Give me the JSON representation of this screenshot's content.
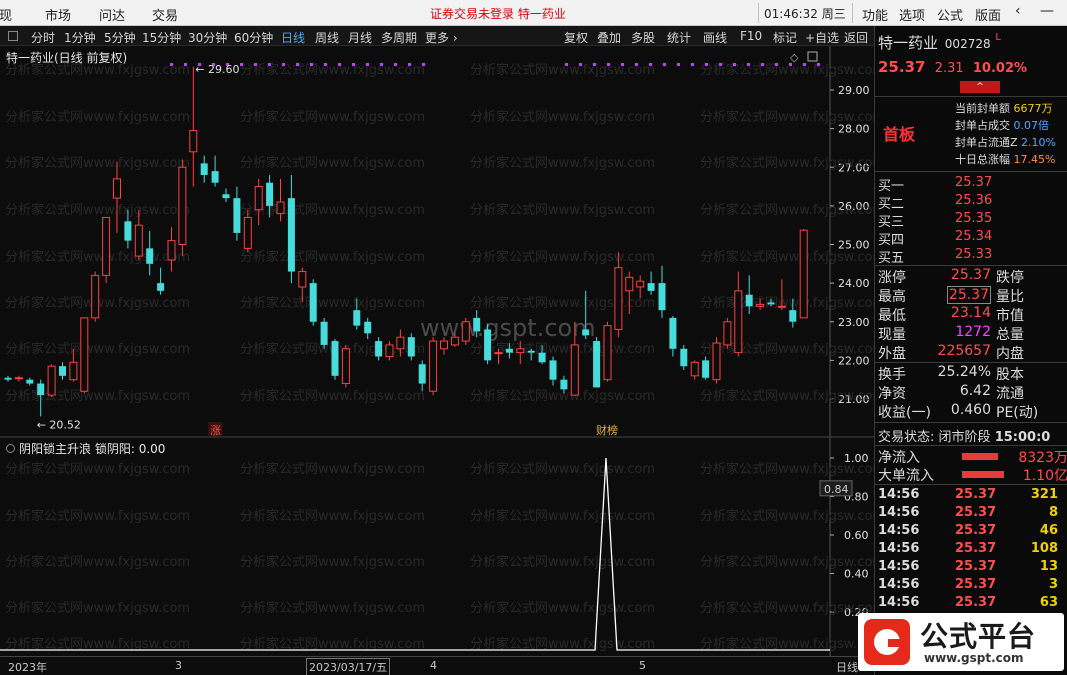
{
  "top_menu": {
    "items": [
      "发现",
      "市场",
      "问达",
      "交易"
    ],
    "center_text": "证券交易未登录  特一药业",
    "clock": "01:46:32 周三",
    "right_items": [
      "功能",
      "选项",
      "公式",
      "版面"
    ],
    "collapse_glyph": "‹",
    "minimize_glyph": "—",
    "close_glyph": "✕"
  },
  "period_bar": {
    "tabs": [
      "分时",
      "1分钟",
      "5分钟",
      "15分钟",
      "30分钟",
      "60分钟",
      "日线",
      "周线",
      "月线",
      "多周期",
      "更多 ›"
    ],
    "active": "日线",
    "tools": [
      "复权",
      "叠加",
      "多股",
      "统计",
      "画线",
      "F10",
      "标记",
      "+自选",
      "返回"
    ]
  },
  "main_chart": {
    "title": "特一药业(日线 前复权)",
    "high_label": "29.60",
    "low_label": "20.52",
    "tags": {
      "zhang": "涨",
      "caibang": "财榜"
    },
    "watermark": "www.gspt.com",
    "watermark_repeat": "分析家公式网www.fxjgsw.com"
  },
  "indicator": {
    "title": "阴阳锁主升浪",
    "var_label": "锁阴阳:",
    "var_value": "0.00",
    "current_value": "0.84"
  },
  "time_axis": {
    "labels": [
      "2023年",
      "3",
      "2023/03/17/五",
      "4",
      "5"
    ],
    "period": "日线"
  },
  "colors": {
    "up": "#ff4040",
    "down": "#46dcdc",
    "axis": "#e0e0e0",
    "dots": "#c040ff",
    "panel_bg": "#0c0c0c"
  },
  "chart_data": [
    {
      "type": "candlestick",
      "title": "特一药业(日线 前复权)",
      "ylim": [
        20.4,
        29.9
      ],
      "y_ticks": [
        "29.00",
        "28.00",
        "27.00",
        "26.00",
        "25.00",
        "24.00",
        "23.00",
        "22.00",
        "21.00"
      ],
      "candles": [
        {
          "o": 21.55,
          "h": 21.6,
          "l": 21.45,
          "c": 21.5
        },
        {
          "o": 21.55,
          "h": 21.6,
          "l": 21.45,
          "c": 21.55
        },
        {
          "o": 21.5,
          "h": 21.55,
          "l": 21.35,
          "c": 21.4
        },
        {
          "o": 21.4,
          "h": 21.5,
          "l": 20.55,
          "c": 21.1
        },
        {
          "o": 21.1,
          "h": 21.9,
          "l": 21.05,
          "c": 21.85
        },
        {
          "o": 21.85,
          "h": 21.95,
          "l": 21.5,
          "c": 21.6
        },
        {
          "o": 21.5,
          "h": 22.3,
          "l": 21.45,
          "c": 21.95
        },
        {
          "o": 21.2,
          "h": 23.1,
          "l": 21.15,
          "c": 23.1
        },
        {
          "o": 23.1,
          "h": 24.3,
          "l": 23.0,
          "c": 24.2
        },
        {
          "o": 24.2,
          "h": 25.7,
          "l": 24.0,
          "c": 25.7
        },
        {
          "o": 26.2,
          "h": 27.15,
          "l": 25.3,
          "c": 26.7
        },
        {
          "o": 25.6,
          "h": 25.9,
          "l": 24.9,
          "c": 25.1
        },
        {
          "o": 24.7,
          "h": 25.9,
          "l": 24.6,
          "c": 25.5
        },
        {
          "o": 24.9,
          "h": 25.35,
          "l": 24.2,
          "c": 24.5
        },
        {
          "o": 24.0,
          "h": 24.4,
          "l": 23.7,
          "c": 23.8
        },
        {
          "o": 24.6,
          "h": 25.45,
          "l": 24.3,
          "c": 25.1
        },
        {
          "o": 25.0,
          "h": 27.2,
          "l": 24.7,
          "c": 27.0
        },
        {
          "o": 27.4,
          "h": 29.6,
          "l": 26.5,
          "c": 27.95
        },
        {
          "o": 27.1,
          "h": 27.3,
          "l": 26.6,
          "c": 26.8
        },
        {
          "o": 26.9,
          "h": 27.3,
          "l": 26.5,
          "c": 26.6
        },
        {
          "o": 26.3,
          "h": 26.45,
          "l": 26.1,
          "c": 26.2
        },
        {
          "o": 26.2,
          "h": 26.5,
          "l": 25.1,
          "c": 25.3
        },
        {
          "o": 24.9,
          "h": 25.9,
          "l": 24.8,
          "c": 25.7
        },
        {
          "o": 25.9,
          "h": 26.7,
          "l": 25.5,
          "c": 26.5
        },
        {
          "o": 26.6,
          "h": 26.8,
          "l": 25.7,
          "c": 26.0
        },
        {
          "o": 25.8,
          "h": 26.7,
          "l": 25.6,
          "c": 26.1
        },
        {
          "o": 26.2,
          "h": 26.8,
          "l": 24.0,
          "c": 24.3
        },
        {
          "o": 23.9,
          "h": 24.4,
          "l": 23.5,
          "c": 24.3
        },
        {
          "o": 24.0,
          "h": 24.1,
          "l": 22.9,
          "c": 23.0
        },
        {
          "o": 23.0,
          "h": 23.1,
          "l": 22.3,
          "c": 22.4
        },
        {
          "o": 22.5,
          "h": 22.55,
          "l": 21.5,
          "c": 21.6
        },
        {
          "o": 21.4,
          "h": 22.4,
          "l": 21.3,
          "c": 22.3
        },
        {
          "o": 23.3,
          "h": 23.6,
          "l": 22.8,
          "c": 22.9
        },
        {
          "o": 23.0,
          "h": 23.1,
          "l": 22.55,
          "c": 22.7
        },
        {
          "o": 22.5,
          "h": 22.6,
          "l": 22.0,
          "c": 22.1
        },
        {
          "o": 22.1,
          "h": 22.5,
          "l": 22.0,
          "c": 22.4
        },
        {
          "o": 22.3,
          "h": 22.8,
          "l": 22.1,
          "c": 22.6
        },
        {
          "o": 22.6,
          "h": 22.7,
          "l": 22.0,
          "c": 22.1
        },
        {
          "o": 21.9,
          "h": 22.0,
          "l": 21.2,
          "c": 21.4
        },
        {
          "o": 21.2,
          "h": 22.6,
          "l": 21.1,
          "c": 22.5
        },
        {
          "o": 22.3,
          "h": 22.6,
          "l": 22.15,
          "c": 22.5
        },
        {
          "o": 22.4,
          "h": 22.7,
          "l": 22.35,
          "c": 22.6
        },
        {
          "o": 22.5,
          "h": 23.1,
          "l": 22.4,
          "c": 23.0
        },
        {
          "o": 23.1,
          "h": 23.3,
          "l": 22.6,
          "c": 22.75
        },
        {
          "o": 22.8,
          "h": 22.95,
          "l": 21.9,
          "c": 22.0
        },
        {
          "o": 22.2,
          "h": 22.3,
          "l": 21.9,
          "c": 22.2
        },
        {
          "o": 22.3,
          "h": 22.45,
          "l": 22.05,
          "c": 22.2
        },
        {
          "o": 22.2,
          "h": 22.5,
          "l": 21.9,
          "c": 22.3
        },
        {
          "o": 22.25,
          "h": 22.3,
          "l": 22.0,
          "c": 22.2
        },
        {
          "o": 22.2,
          "h": 22.4,
          "l": 21.9,
          "c": 21.95
        },
        {
          "o": 22.0,
          "h": 22.1,
          "l": 21.35,
          "c": 21.5
        },
        {
          "o": 21.5,
          "h": 21.6,
          "l": 21.15,
          "c": 21.25
        },
        {
          "o": 21.1,
          "h": 23.0,
          "l": 21.1,
          "c": 22.4
        },
        {
          "o": 22.8,
          "h": 23.8,
          "l": 22.55,
          "c": 22.65
        },
        {
          "o": 22.5,
          "h": 22.6,
          "l": 21.3,
          "c": 21.3
        },
        {
          "o": 21.5,
          "h": 23.0,
          "l": 21.45,
          "c": 22.9
        },
        {
          "o": 22.8,
          "h": 24.8,
          "l": 22.6,
          "c": 24.4
        },
        {
          "o": 23.8,
          "h": 24.3,
          "l": 23.2,
          "c": 24.15
        },
        {
          "o": 23.9,
          "h": 24.2,
          "l": 23.6,
          "c": 24.05
        },
        {
          "o": 24.0,
          "h": 24.3,
          "l": 23.7,
          "c": 23.8
        },
        {
          "o": 24.0,
          "h": 24.45,
          "l": 23.1,
          "c": 23.3
        },
        {
          "o": 23.1,
          "h": 23.15,
          "l": 22.1,
          "c": 22.3
        },
        {
          "o": 22.3,
          "h": 22.4,
          "l": 21.75,
          "c": 21.85
        },
        {
          "o": 21.6,
          "h": 22.0,
          "l": 21.5,
          "c": 21.95
        },
        {
          "o": 22.0,
          "h": 22.1,
          "l": 21.5,
          "c": 21.55
        },
        {
          "o": 21.5,
          "h": 22.6,
          "l": 21.4,
          "c": 22.45
        },
        {
          "o": 22.4,
          "h": 23.1,
          "l": 22.3,
          "c": 23.0
        },
        {
          "o": 22.2,
          "h": 24.3,
          "l": 22.1,
          "c": 23.8
        },
        {
          "o": 23.7,
          "h": 24.2,
          "l": 23.2,
          "c": 23.4
        },
        {
          "o": 23.4,
          "h": 23.6,
          "l": 23.3,
          "c": 23.45
        },
        {
          "o": 23.5,
          "h": 23.6,
          "l": 23.4,
          "c": 23.45
        },
        {
          "o": 23.4,
          "h": 24.1,
          "l": 23.3,
          "c": 23.4
        },
        {
          "o": 23.3,
          "h": 23.6,
          "l": 22.85,
          "c": 23.0
        },
        {
          "o": 23.1,
          "h": 25.4,
          "l": 23.1,
          "c": 25.37
        }
      ],
      "tag_candle_index": {
        "zhang": 19,
        "caibang": 74
      }
    },
    {
      "type": "line",
      "title": "阴阳锁主升浪",
      "ylim": [
        0,
        1.05
      ],
      "y_ticks": [
        "1.00",
        "0.80",
        "0.60",
        "0.40",
        "0.20"
      ],
      "values_note": "zero everywhere except a single spike to 1.00 at candle 74",
      "spike_index": 74,
      "spike_value": 1.0
    }
  ],
  "right_panel": {
    "stock_name": "特一药业",
    "stock_code": "002728",
    "margin_tag": "L",
    "price": "25.37",
    "change": "2.31",
    "change_pct": "10.02%",
    "badge": "首板",
    "limit_info": [
      {
        "label": "当前封单额",
        "value": "6677万"
      },
      {
        "label": "封单占成交",
        "value": "0.07倍"
      },
      {
        "label": "封单占流通Z",
        "value": "2.10%"
      },
      {
        "label": "十日总涨幅",
        "value": "17.45%"
      }
    ],
    "bids": [
      {
        "label": "买一",
        "price": "25.37"
      },
      {
        "label": "买二",
        "price": "25.36"
      },
      {
        "label": "买三",
        "price": "25.35"
      },
      {
        "label": "买四",
        "price": "25.34"
      },
      {
        "label": "买五",
        "price": "25.33"
      }
    ],
    "quotes": [
      {
        "l1": "涨停",
        "v1": "25.37",
        "l2": "跌停"
      },
      {
        "l1": "最高",
        "v1": "25.37",
        "l2": "量比"
      },
      {
        "l1": "最低",
        "v1": "23.14",
        "l2": "市值"
      },
      {
        "l1": "现量",
        "v1": "1272",
        "l2": "总量"
      },
      {
        "l1": "外盘",
        "v1": "225657",
        "l2": "内盘"
      }
    ],
    "stats": [
      {
        "l1": "换手",
        "v1": "25.24%",
        "l2": "股本"
      },
      {
        "l1": "净资",
        "v1": "6.42",
        "l2": "流通"
      },
      {
        "l1": "收益(一)",
        "v1": "0.460",
        "l2": "PE(动)"
      }
    ],
    "trade_status": {
      "label": "交易状态:",
      "value": "闭市阶段",
      "time": "15:00:0"
    },
    "flows": [
      {
        "label": "净流入",
        "value": "8323万"
      },
      {
        "label": "大单流入",
        "value": "1.10亿"
      }
    ],
    "ticks": [
      {
        "time": "14:56",
        "price": "25.37",
        "vol": "321"
      },
      {
        "time": "14:56",
        "price": "25.37",
        "vol": "8"
      },
      {
        "time": "14:56",
        "price": "25.37",
        "vol": "46"
      },
      {
        "time": "14:56",
        "price": "25.37",
        "vol": "108"
      },
      {
        "time": "14:56",
        "price": "25.37",
        "vol": "13"
      },
      {
        "time": "14:56",
        "price": "25.37",
        "vol": "3"
      },
      {
        "time": "14:56",
        "price": "25.37",
        "vol": "63"
      },
      {
        "time": "14:56",
        "price": "",
        "vol": ""
      }
    ]
  },
  "logo": {
    "name": "公式平台",
    "url": "www.gspt.com"
  }
}
